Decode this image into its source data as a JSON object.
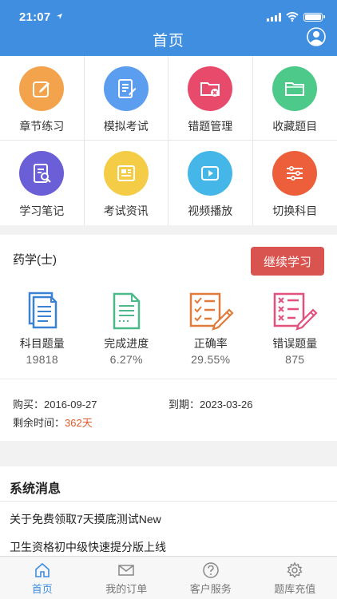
{
  "status": {
    "time": "21:07"
  },
  "header": {
    "title": "首页"
  },
  "menu": {
    "items": [
      {
        "label": "章节练习",
        "icon": "pencil-edit-icon",
        "color": "#f2a34c"
      },
      {
        "label": "模拟考试",
        "icon": "exam-paper-icon",
        "color": "#5b9ef0"
      },
      {
        "label": "错题管理",
        "icon": "error-folder-icon",
        "color": "#e84a6b"
      },
      {
        "label": "收藏题目",
        "icon": "folder-icon",
        "color": "#4dc98a"
      },
      {
        "label": "学习笔记",
        "icon": "notes-search-icon",
        "color": "#6a5fd6"
      },
      {
        "label": "考试资讯",
        "icon": "newspaper-icon",
        "color": "#f4cc46"
      },
      {
        "label": "视频播放",
        "icon": "video-play-icon",
        "color": "#45b6e8"
      },
      {
        "label": "切换科目",
        "icon": "sliders-icon",
        "color": "#ec5f3a"
      }
    ]
  },
  "course": {
    "name": "药学(士)",
    "continue_label": "继续学习",
    "stats": [
      {
        "label": "科目题量",
        "value": "19818",
        "icon": "documents-icon",
        "color": "#3b82d4"
      },
      {
        "label": "完成进度",
        "value": "6.27%",
        "icon": "document-lines-icon",
        "color": "#4bb98a"
      },
      {
        "label": "正确率",
        "value": "29.55%",
        "icon": "checklist-icon",
        "color": "#e07a3a"
      },
      {
        "label": "错误题量",
        "value": "875",
        "icon": "error-list-icon",
        "color": "#e2507c"
      }
    ],
    "purchase_label": "购买：",
    "purchase_date": "2016-09-27",
    "expire_label": "到期：",
    "expire_date": "2023-03-26",
    "remaining_label": "剩余时间：",
    "remaining_value": "362天"
  },
  "news": {
    "title": "系统消息",
    "items": [
      "关于免费领取7天摸底测试New",
      "卫生资格初中级快速提分版上线"
    ]
  },
  "tabs": [
    {
      "label": "首页",
      "icon": "home-icon",
      "active": true
    },
    {
      "label": "我的订单",
      "icon": "mail-icon",
      "active": false
    },
    {
      "label": "客户服务",
      "icon": "help-icon",
      "active": false
    },
    {
      "label": "题库充值",
      "icon": "gear-icon",
      "active": false
    }
  ]
}
